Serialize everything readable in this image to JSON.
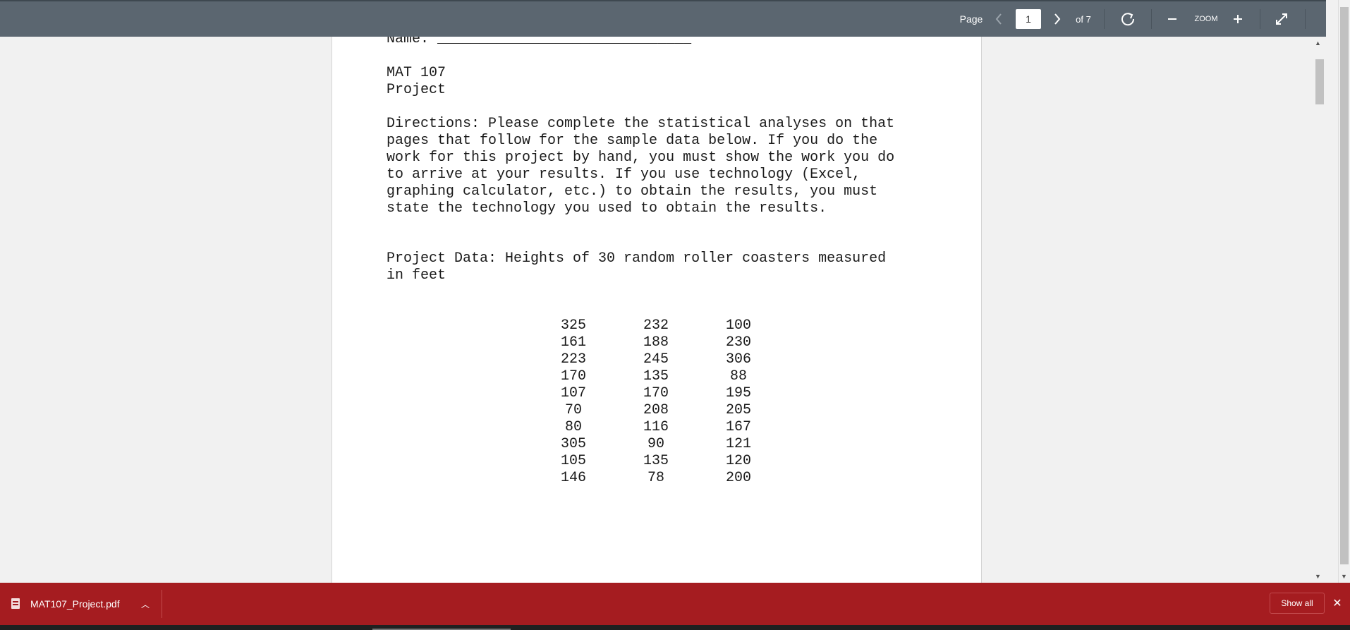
{
  "toolbar": {
    "page_label": "Page",
    "current_page": "1",
    "page_total": "of 7",
    "zoom_label": "ZOOM",
    "icons": [
      "chevron-left-icon",
      "chevron-right-icon",
      "rotate-icon",
      "minus-icon",
      "plus-icon",
      "fullscreen-icon"
    ]
  },
  "document": {
    "name_line": "Name: ______________________________",
    "course": "MAT 107",
    "title": "Project",
    "directions": [
      "Directions: Please complete the statistical analyses on that",
      "pages that follow for the sample data below. If you do the",
      "work for this project by hand, you must show the work you do",
      "to arrive at your results. If you use technology (Excel,",
      "graphing calculator, etc.) to obtain the results, you must",
      "state the technology you used to obtain the results."
    ],
    "project_data": [
      "Project Data: Heights of 30 random roller coasters measured",
      "in feet"
    ],
    "data_columns": [
      [
        "325",
        "161",
        "223",
        "170",
        "107",
        "70",
        "80",
        "305",
        "105",
        "146"
      ],
      [
        "232",
        "188",
        "245",
        "135",
        "170",
        "208",
        "116",
        "90",
        "135",
        "78"
      ],
      [
        "100",
        "230",
        "306",
        "88",
        "195",
        "205",
        "167",
        "121",
        "120",
        "200"
      ]
    ]
  },
  "download_bar": {
    "filename": "MAT107_Project.pdf",
    "show_all": "Show all"
  }
}
